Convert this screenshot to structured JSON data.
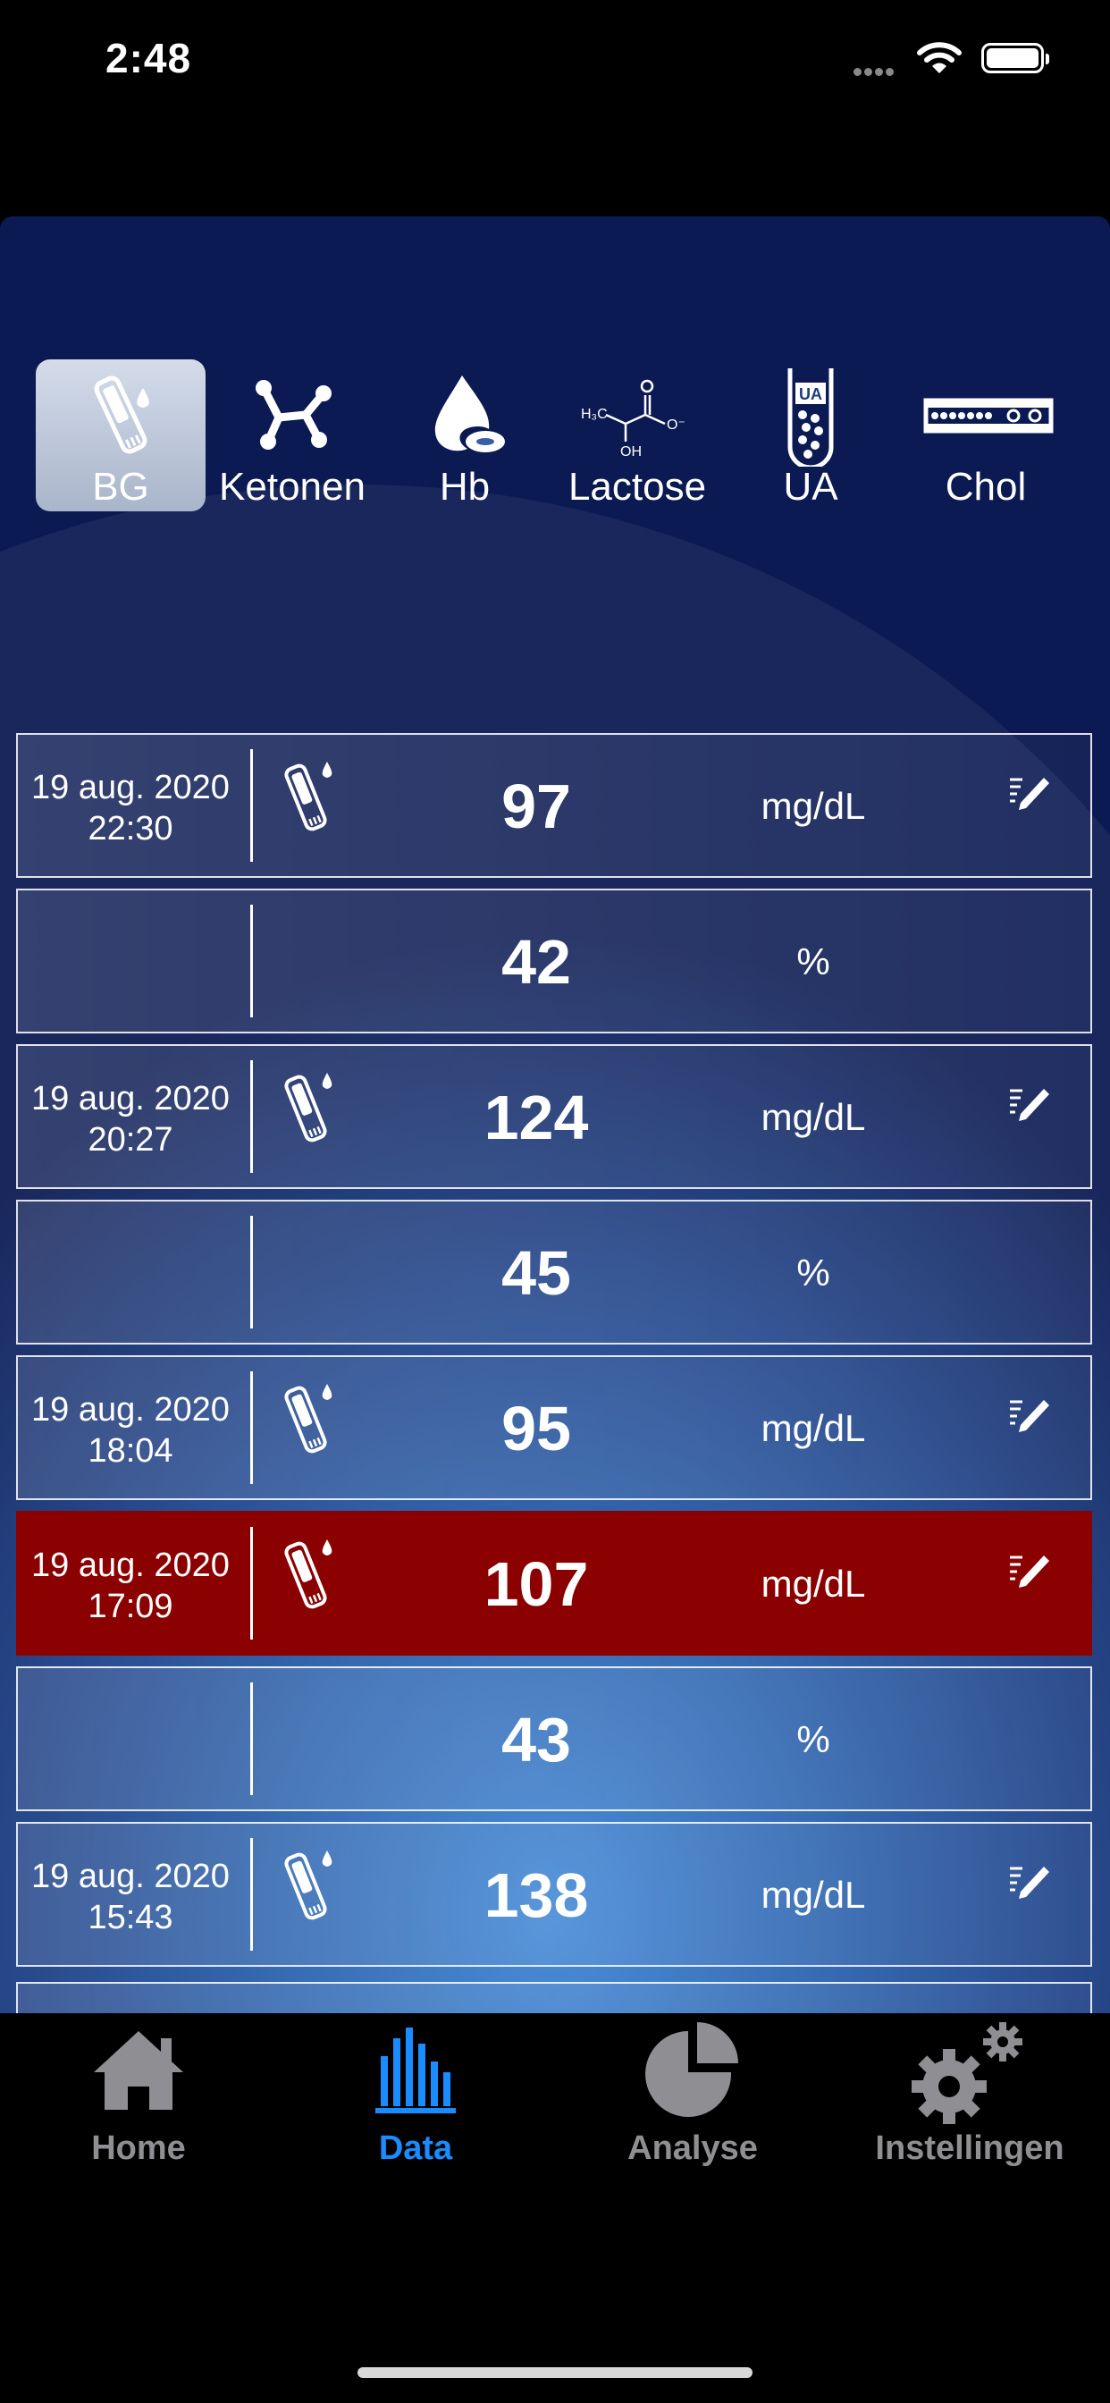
{
  "status_bar": {
    "time": "2:48"
  },
  "categories": [
    {
      "label": "BG",
      "icon": "test-strip-icon",
      "active": true
    },
    {
      "label": "Ketonen",
      "icon": "molecule-icon",
      "active": false
    },
    {
      "label": "Hb",
      "icon": "blood-drop-icon",
      "active": false
    },
    {
      "label": "Lactose",
      "icon": "lactate-formula-icon",
      "active": false
    },
    {
      "label": "UA",
      "icon": "uric-acid-tube-icon",
      "active": false
    },
    {
      "label": "Chol",
      "icon": "cholesterol-vessel-icon",
      "active": false
    }
  ],
  "records": [
    {
      "date": "19 aug. 2020",
      "time": "22:30",
      "value": "97",
      "unit": "mg/dL",
      "strip": true,
      "edit": true,
      "alert": false
    },
    {
      "date": "",
      "time": "",
      "value": "42",
      "unit": "%",
      "strip": false,
      "edit": false,
      "alert": false
    },
    {
      "date": "19 aug. 2020",
      "time": "20:27",
      "value": "124",
      "unit": "mg/dL",
      "strip": true,
      "edit": true,
      "alert": false
    },
    {
      "date": "",
      "time": "",
      "value": "45",
      "unit": "%",
      "strip": false,
      "edit": false,
      "alert": false
    },
    {
      "date": "19 aug. 2020",
      "time": "18:04",
      "value": "95",
      "unit": "mg/dL",
      "strip": true,
      "edit": true,
      "alert": false
    },
    {
      "date": "19 aug. 2020",
      "time": "17:09",
      "value": "107",
      "unit": "mg/dL",
      "strip": true,
      "edit": true,
      "alert": true
    },
    {
      "date": "",
      "time": "",
      "value": "43",
      "unit": "%",
      "strip": false,
      "edit": false,
      "alert": false
    },
    {
      "date": "19 aug. 2020",
      "time": "15:43",
      "value": "138",
      "unit": "mg/dL",
      "strip": true,
      "edit": true,
      "alert": false
    }
  ],
  "tabbar": [
    {
      "label": "Home",
      "icon": "home-icon",
      "active": false
    },
    {
      "label": "Data",
      "icon": "bar-chart-icon",
      "active": true
    },
    {
      "label": "Analyse",
      "icon": "pie-chart-icon",
      "active": false
    },
    {
      "label": "Instellingen",
      "icon": "gears-icon",
      "active": false
    }
  ],
  "colors": {
    "alert_row": "#8b0000",
    "active_tab": "#1a8cff",
    "inactive_tab": "#8e8e93"
  }
}
